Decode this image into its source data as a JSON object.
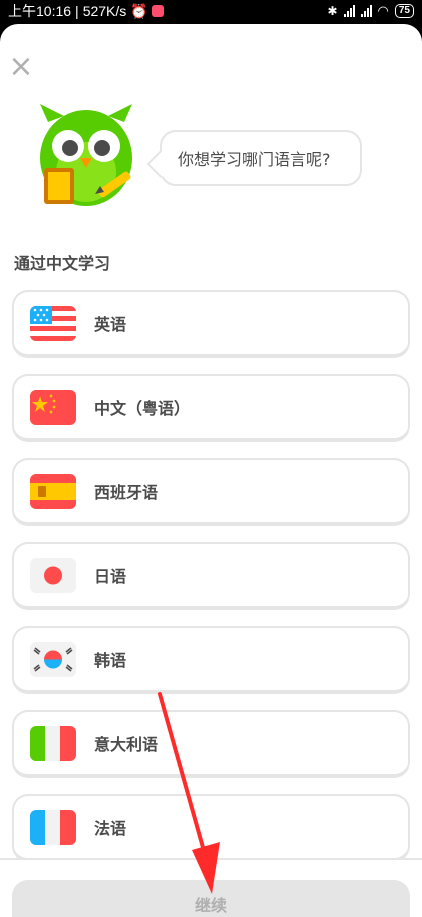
{
  "status_bar": {
    "time": "上午10:16",
    "speed": "527K/s",
    "battery": "75"
  },
  "header": {
    "close_icon": "close-icon",
    "prompt": "你想学习哪门语言呢?"
  },
  "section_title": "通过中文学习",
  "languages": [
    {
      "label": "英语",
      "flag": "us-flag-icon"
    },
    {
      "label": "中文（粤语）",
      "flag": "china-flag-icon"
    },
    {
      "label": "西班牙语",
      "flag": "spain-flag-icon"
    },
    {
      "label": "日语",
      "flag": "japan-flag-icon"
    },
    {
      "label": "韩语",
      "flag": "korea-flag-icon"
    },
    {
      "label": "意大利语",
      "flag": "italy-flag-icon"
    },
    {
      "label": "法语",
      "flag": "france-flag-icon"
    }
  ],
  "footer": {
    "continue_label": "继续"
  },
  "colors": {
    "owl_green": "#58cc02",
    "disabled_button": "#e5e5e5",
    "annotation_red": "#ff2b2b"
  }
}
